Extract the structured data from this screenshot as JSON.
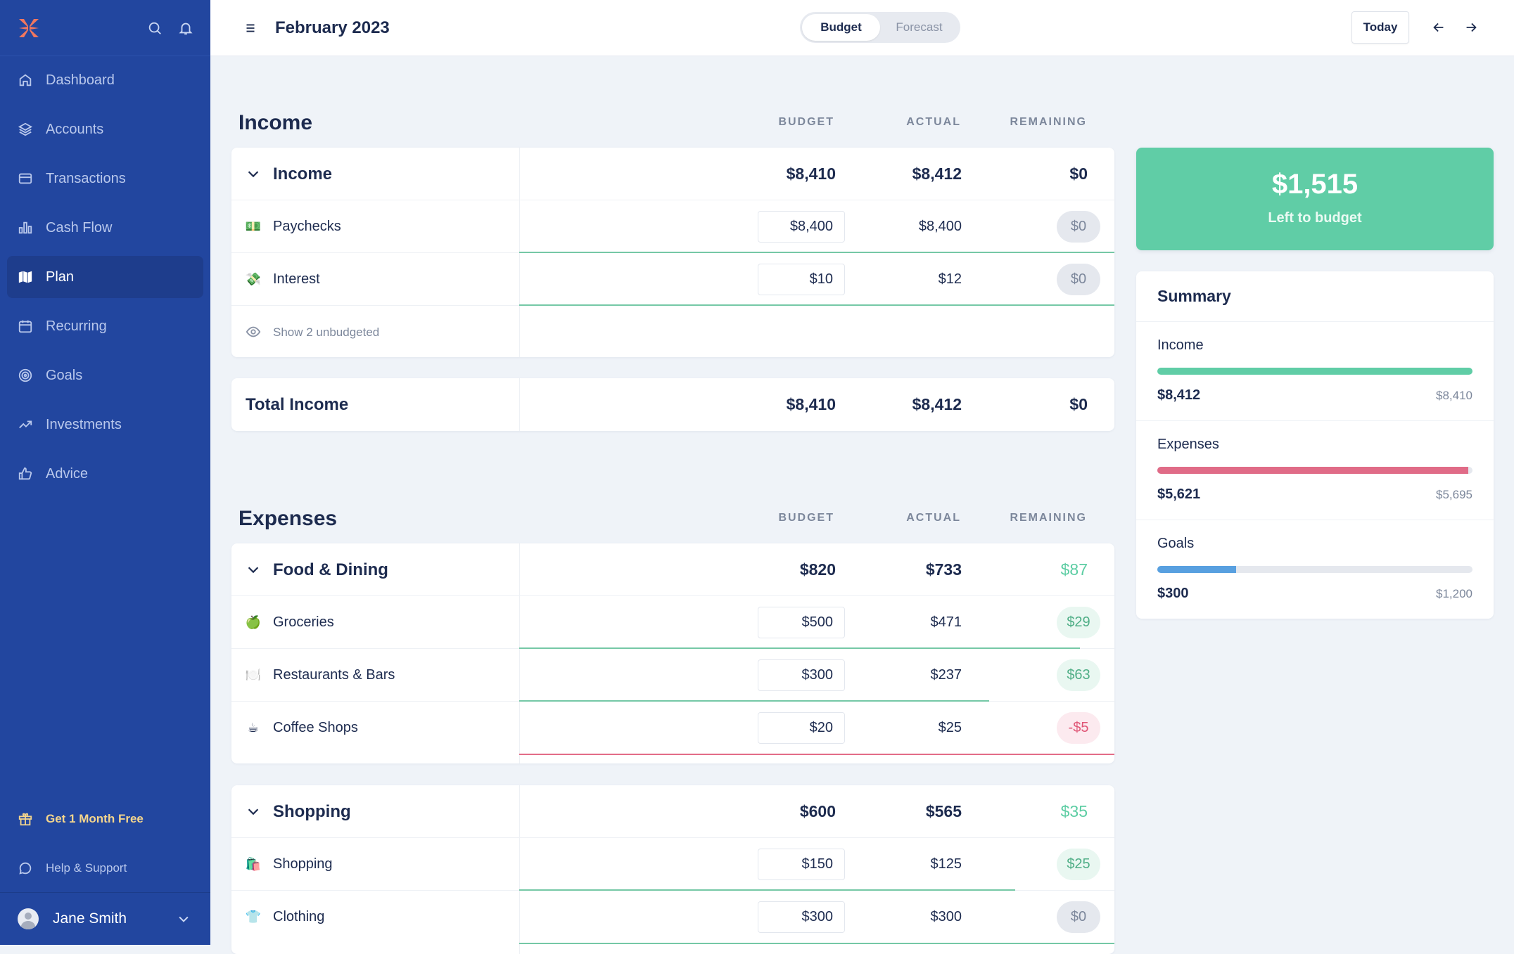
{
  "sidebar": {
    "logo": "monarch-logo",
    "nav": [
      {
        "label": "Dashboard",
        "icon": "home-icon",
        "active": false
      },
      {
        "label": "Accounts",
        "icon": "layers-icon",
        "active": false
      },
      {
        "label": "Transactions",
        "icon": "credit-card-icon",
        "active": false
      },
      {
        "label": "Cash Flow",
        "icon": "bar-chart-icon",
        "active": false
      },
      {
        "label": "Plan",
        "icon": "map-icon",
        "active": true
      },
      {
        "label": "Recurring",
        "icon": "calendar-icon",
        "active": false
      },
      {
        "label": "Goals",
        "icon": "target-icon",
        "active": false
      },
      {
        "label": "Investments",
        "icon": "trending-up-icon",
        "active": false
      },
      {
        "label": "Advice",
        "icon": "thumbs-up-icon",
        "active": false
      }
    ],
    "promo": "Get 1 Month Free",
    "help": "Help & Support",
    "user": "Jane Smith"
  },
  "topbar": {
    "title": "February 2023",
    "toggle": [
      "Budget",
      "Forecast"
    ],
    "toggle_selected": "Budget",
    "today": "Today"
  },
  "columns": {
    "budget": "BUDGET",
    "actual": "ACTUAL",
    "remaining": "REMAINING"
  },
  "income": {
    "title": "Income",
    "group": {
      "label": "Income",
      "budget": "$8,410",
      "actual": "$8,412",
      "remaining": "$0"
    },
    "rows": [
      {
        "icon": "💵",
        "label": "Paychecks",
        "budget": "$8,400",
        "actual": "$8,400",
        "remaining": "$0",
        "status": "zero",
        "progress": 1.0
      },
      {
        "icon": "💸",
        "label": "Interest",
        "budget": "$10",
        "actual": "$12",
        "remaining": "$0",
        "status": "zero",
        "progress": 1.0
      }
    ],
    "unbudgeted": "Show 2 unbudgeted",
    "total": {
      "label": "Total Income",
      "budget": "$8,410",
      "actual": "$8,412",
      "remaining": "$0"
    }
  },
  "expenses": {
    "title": "Expenses",
    "groups": [
      {
        "label": "Food & Dining",
        "budget": "$820",
        "actual": "$733",
        "remaining": "$87",
        "rows": [
          {
            "icon": "🍏",
            "label": "Groceries",
            "budget": "$500",
            "actual": "$471",
            "remaining": "$29",
            "status": "pos",
            "progress": 0.942
          },
          {
            "icon": "🍽️",
            "label": "Restaurants & Bars",
            "budget": "$300",
            "actual": "$237",
            "remaining": "$63",
            "status": "pos",
            "progress": 0.79
          },
          {
            "icon": "☕",
            "label": "Coffee Shops",
            "budget": "$20",
            "actual": "$25",
            "remaining": "-$5",
            "status": "neg",
            "progress": 1.0
          }
        ]
      },
      {
        "label": "Shopping",
        "budget": "$600",
        "actual": "$565",
        "remaining": "$35",
        "rows": [
          {
            "icon": "🛍️",
            "label": "Shopping",
            "budget": "$150",
            "actual": "$125",
            "remaining": "$25",
            "status": "pos",
            "progress": 0.833
          },
          {
            "icon": "👕",
            "label": "Clothing",
            "budget": "$300",
            "actual": "$300",
            "remaining": "$0",
            "status": "zero",
            "progress": 1.0
          }
        ]
      }
    ]
  },
  "left_to_budget": {
    "amount": "$1,515",
    "label": "Left to budget",
    "color": "#60cda6"
  },
  "summary": {
    "title": "Summary",
    "items": [
      {
        "label": "Income",
        "actual": "$8,412",
        "budget": "$8,410",
        "progress": 1.0,
        "color": "#60cda6"
      },
      {
        "label": "Expenses",
        "actual": "$5,621",
        "budget": "$5,695",
        "progress": 0.987,
        "color": "#e06b87"
      },
      {
        "label": "Goals",
        "actual": "$300",
        "budget": "$1,200",
        "progress": 0.25,
        "color": "#58a0e0"
      }
    ]
  }
}
